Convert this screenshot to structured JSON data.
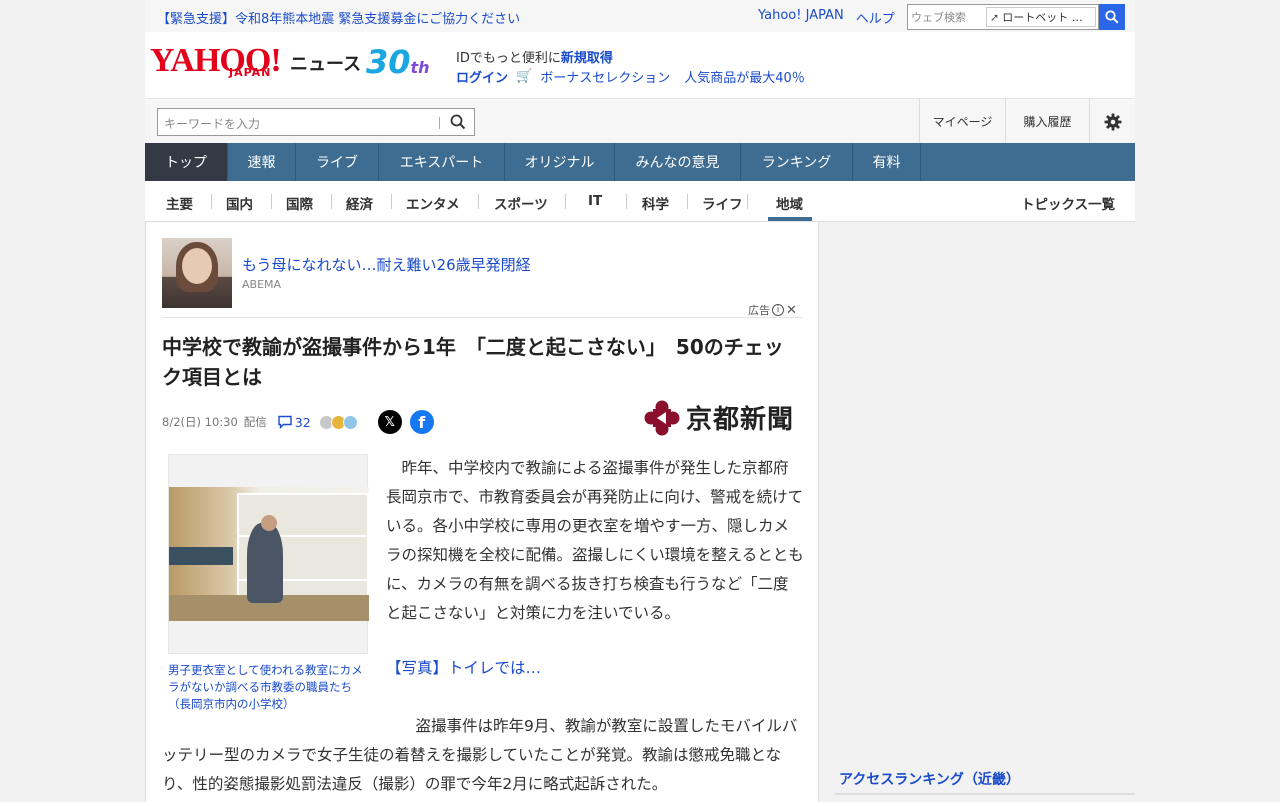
{
  "topbar": {
    "alert": "【緊急支援】令和8年熊本地震 緊急支援募金にご協力ください",
    "links": [
      "Yahoo! JAPAN",
      "ヘルプ"
    ],
    "web_search_placeholder": "ウェブ検索",
    "extension_label": "ロートベット …"
  },
  "brand": {
    "logo": "YAHOO!",
    "logo_sub": "JAPAN",
    "service": "ニュース",
    "anniversary": "30",
    "anniversary_suffix": "th"
  },
  "account": {
    "line1_prefix": "IDでもっと便利に",
    "line1_link": "新規取得",
    "login": "ログイン",
    "bonus": "ボーナスセレクション",
    "promo": "人気商品が最大40％"
  },
  "search": {
    "placeholder": "キーワードを入力",
    "mypage": "マイページ",
    "history": "購入履歴"
  },
  "global_nav": [
    {
      "label": "トップ",
      "w": 83
    },
    {
      "label": "速報",
      "w": 68
    },
    {
      "label": "ライブ",
      "w": 83
    },
    {
      "label": "エキスパート",
      "w": 126
    },
    {
      "label": "オリジナル",
      "w": 110
    },
    {
      "label": "みんなの意見",
      "w": 126
    },
    {
      "label": "ランキング",
      "w": 112
    },
    {
      "label": "有料",
      "w": 68
    }
  ],
  "sub_nav": [
    "主要",
    "国内",
    "国際",
    "経済",
    "エンタメ",
    "スポーツ",
    "IT",
    "科学",
    "ライフ",
    "地域"
  ],
  "sub_nav_right": "トピックス一覧",
  "ad": {
    "title": "もう母になれない…耐え難い26歳早発閉経",
    "source": "ABEMA",
    "label": "広告"
  },
  "article": {
    "headline": "中学校で教諭が盗撮事件から1年　「二度と起こさない」　50のチェック項目とは",
    "date": "8/2(日) 10:30",
    "delivered": "配信",
    "comments": "32",
    "publisher": "京都新聞",
    "photo_caption": "男子更衣室として使われる教室にカメラがないか調べる市教委の職員たち（長岡京市内の小学校）",
    "para1": "　昨年、中学校内で教諭による盗撮事件が発生した京都府長岡京市で、市教育委員会が再発防止に向け、警戒を続けている。各小中学校に専用の更衣室を増やす一方、隠しカメラの探知機を全校に配備。盗撮しにくい環境を整えるとともに、カメラの有無を調べる抜き打ち検査も行うなど「二度と起こさない」と対策に力を注いでいる。",
    "photo_link": "【写真】トイレでは…",
    "para2": "　盗撮事件は昨年9月、教諭が教室に設置したモバイルバッテリー型のカメラで女子生徒の着替えを撮影していたことが発覚。教諭は懲戒免職となり、性的姿態撮影処罰法違反（撮影）の罪で今年2月に略式起訴された。"
  },
  "sidebar": {
    "ranking_title": "アクセスランキング（近畿）"
  },
  "colors": {
    "accent_link": "#1a4bcb",
    "nav_bg": "#3e6d91",
    "nav_active": "#333a45",
    "brand_red": "#e2001a"
  }
}
